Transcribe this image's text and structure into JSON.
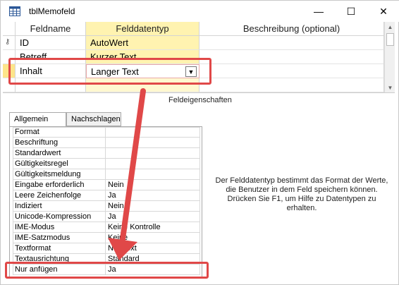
{
  "window": {
    "title": "tblMemofeld",
    "minimize_glyph": "—",
    "maximize_glyph": "☐",
    "close_glyph": "✕"
  },
  "grid": {
    "headers": {
      "name": "Feldname",
      "type": "Felddatentyp",
      "description": "Beschreibung (optional)"
    },
    "rows": [
      {
        "name": "ID",
        "type": "AutoWert",
        "description": ""
      },
      {
        "name": "Betreff",
        "type": "Kurzer Text",
        "description": ""
      },
      {
        "name": "Inhalt",
        "type": "Langer Text",
        "description": ""
      }
    ]
  },
  "properties": {
    "section_title": "Feldeigenschaften",
    "tabs": [
      "Allgemein",
      "Nachschlagen"
    ],
    "rows": [
      {
        "label": "Format",
        "value": ""
      },
      {
        "label": "Beschriftung",
        "value": ""
      },
      {
        "label": "Standardwert",
        "value": ""
      },
      {
        "label": "Gültigkeitsregel",
        "value": ""
      },
      {
        "label": "Gültigkeitsmeldung",
        "value": ""
      },
      {
        "label": "Eingabe erforderlich",
        "value": "Nein"
      },
      {
        "label": "Leere Zeichenfolge",
        "value": "Ja"
      },
      {
        "label": "Indiziert",
        "value": "Nein"
      },
      {
        "label": "Unicode-Kompression",
        "value": "Ja"
      },
      {
        "label": "IME-Modus",
        "value": "Keine Kontrolle"
      },
      {
        "label": "IME-Satzmodus",
        "value": "Keine"
      },
      {
        "label": "Textformat",
        "value": "Nur Text"
      },
      {
        "label": "Textausrichtung",
        "value": "Standard"
      },
      {
        "label": "Nur anfügen",
        "value": "Ja"
      }
    ],
    "help_text": "Der Felddatentyp bestimmt das Format der Werte, die Benutzer in dem Feld speichern können. Drücken Sie F1, um Hilfe zu Datentypen zu erhalten."
  },
  "colors": {
    "annotation_red": "#e04848",
    "active_column": "#fff3b0",
    "row_selector_active": "#fde58a"
  },
  "icons": {
    "app": "table-icon",
    "primary_key": "key-icon",
    "dropdown": "chevron-down-icon"
  }
}
